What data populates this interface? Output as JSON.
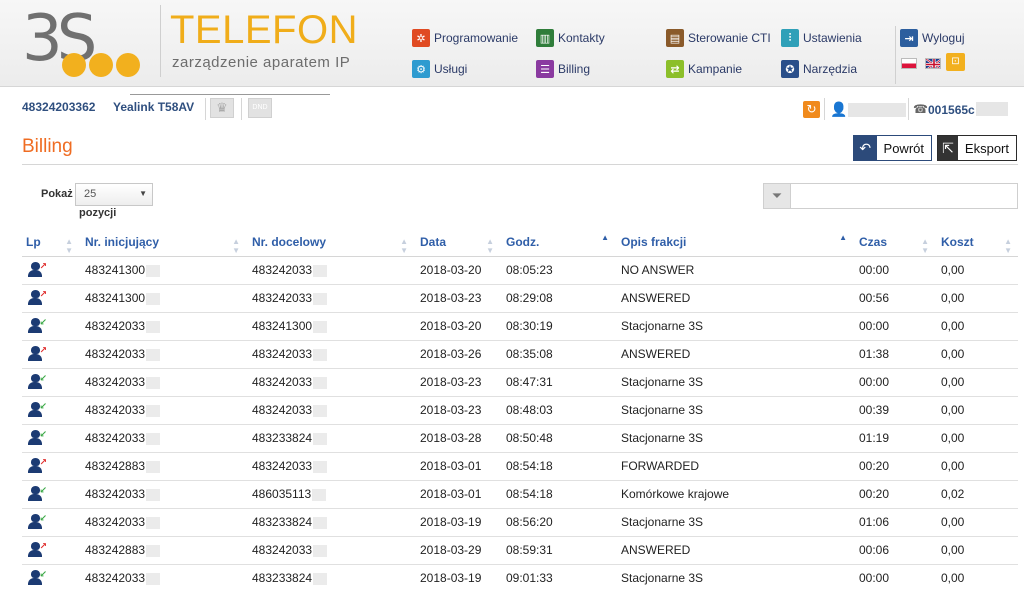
{
  "header": {
    "logo_text": "3S",
    "title": "TELEFON",
    "subtitle": "zarządzenie aparatem IP",
    "nav": {
      "programowanie": "Programowanie",
      "kontakty": "Kontakty",
      "sterowanie": "Sterowanie CTI",
      "ustawienia": "Ustawienia",
      "wyloguj": "Wyloguj",
      "uslugi": "Usługi",
      "billing": "Billing",
      "kampanie": "Kampanie",
      "narzedzia": "Narzędzia"
    }
  },
  "device": {
    "number": "48324203362",
    "model": "Yealink T58AV",
    "dnd": "DND",
    "phone_number": "001565c"
  },
  "page": {
    "title": "Billing",
    "back_button": "Powrót",
    "export_button": "Eksport",
    "show_label": "Pokaż",
    "show_value": "25",
    "show_suffix": "pozycji"
  },
  "table": {
    "headers": {
      "lp": "Lp",
      "initiating": "Nr. inicjujący",
      "target": "Nr. docelowy",
      "date": "Data",
      "time": "Godz.",
      "description": "Opis frakcji",
      "duration": "Czas",
      "cost": "Koszt"
    },
    "rows": [
      {
        "dir": "out",
        "initiating": "483241300",
        "target": "483242033",
        "date": "2018-03-20",
        "time": "08:05:23",
        "description": "NO ANSWER",
        "duration": "00:00",
        "cost": "0,00"
      },
      {
        "dir": "out",
        "initiating": "483241300",
        "target": "483242033",
        "date": "2018-03-23",
        "time": "08:29:08",
        "description": "ANSWERED",
        "duration": "00:56",
        "cost": "0,00"
      },
      {
        "dir": "in",
        "initiating": "483242033",
        "target": "483241300",
        "date": "2018-03-20",
        "time": "08:30:19",
        "description": "Stacjonarne 3S",
        "duration": "00:00",
        "cost": "0,00"
      },
      {
        "dir": "out",
        "initiating": "483242033",
        "target": "483242033",
        "date": "2018-03-26",
        "time": "08:35:08",
        "description": "ANSWERED",
        "duration": "01:38",
        "cost": "0,00"
      },
      {
        "dir": "in",
        "initiating": "483242033",
        "target": "483242033",
        "date": "2018-03-23",
        "time": "08:47:31",
        "description": "Stacjonarne 3S",
        "duration": "00:00",
        "cost": "0,00"
      },
      {
        "dir": "in",
        "initiating": "483242033",
        "target": "483242033",
        "date": "2018-03-23",
        "time": "08:48:03",
        "description": "Stacjonarne 3S",
        "duration": "00:39",
        "cost": "0,00"
      },
      {
        "dir": "in",
        "initiating": "483242033",
        "target": "483233824",
        "date": "2018-03-28",
        "time": "08:50:48",
        "description": "Stacjonarne 3S",
        "duration": "01:19",
        "cost": "0,00"
      },
      {
        "dir": "out",
        "initiating": "483242883",
        "target": "483242033",
        "date": "2018-03-01",
        "time": "08:54:18",
        "description": "FORWARDED",
        "duration": "00:20",
        "cost": "0,00"
      },
      {
        "dir": "in",
        "initiating": "483242033",
        "target": "486035113",
        "date": "2018-03-01",
        "time": "08:54:18",
        "description": "Komórkowe krajowe",
        "duration": "00:20",
        "cost": "0,02"
      },
      {
        "dir": "in",
        "initiating": "483242033",
        "target": "483233824",
        "date": "2018-03-19",
        "time": "08:56:20",
        "description": "Stacjonarne 3S",
        "duration": "01:06",
        "cost": "0,00"
      },
      {
        "dir": "out",
        "initiating": "483242883",
        "target": "483242033",
        "date": "2018-03-29",
        "time": "08:59:31",
        "description": "ANSWERED",
        "duration": "00:06",
        "cost": "0,00"
      },
      {
        "dir": "in",
        "initiating": "483242033",
        "target": "483233824",
        "date": "2018-03-19",
        "time": "09:01:33",
        "description": "Stacjonarne 3S",
        "duration": "00:00",
        "cost": "0,00"
      }
    ]
  },
  "colors": {
    "accent_orange": "#ef6c22",
    "title_yellow": "#f0ad1a",
    "link_blue": "#2f5ea8",
    "nav_navy": "#2b3a67",
    "arrow_in": "#3aa845",
    "arrow_out": "#e03030"
  }
}
